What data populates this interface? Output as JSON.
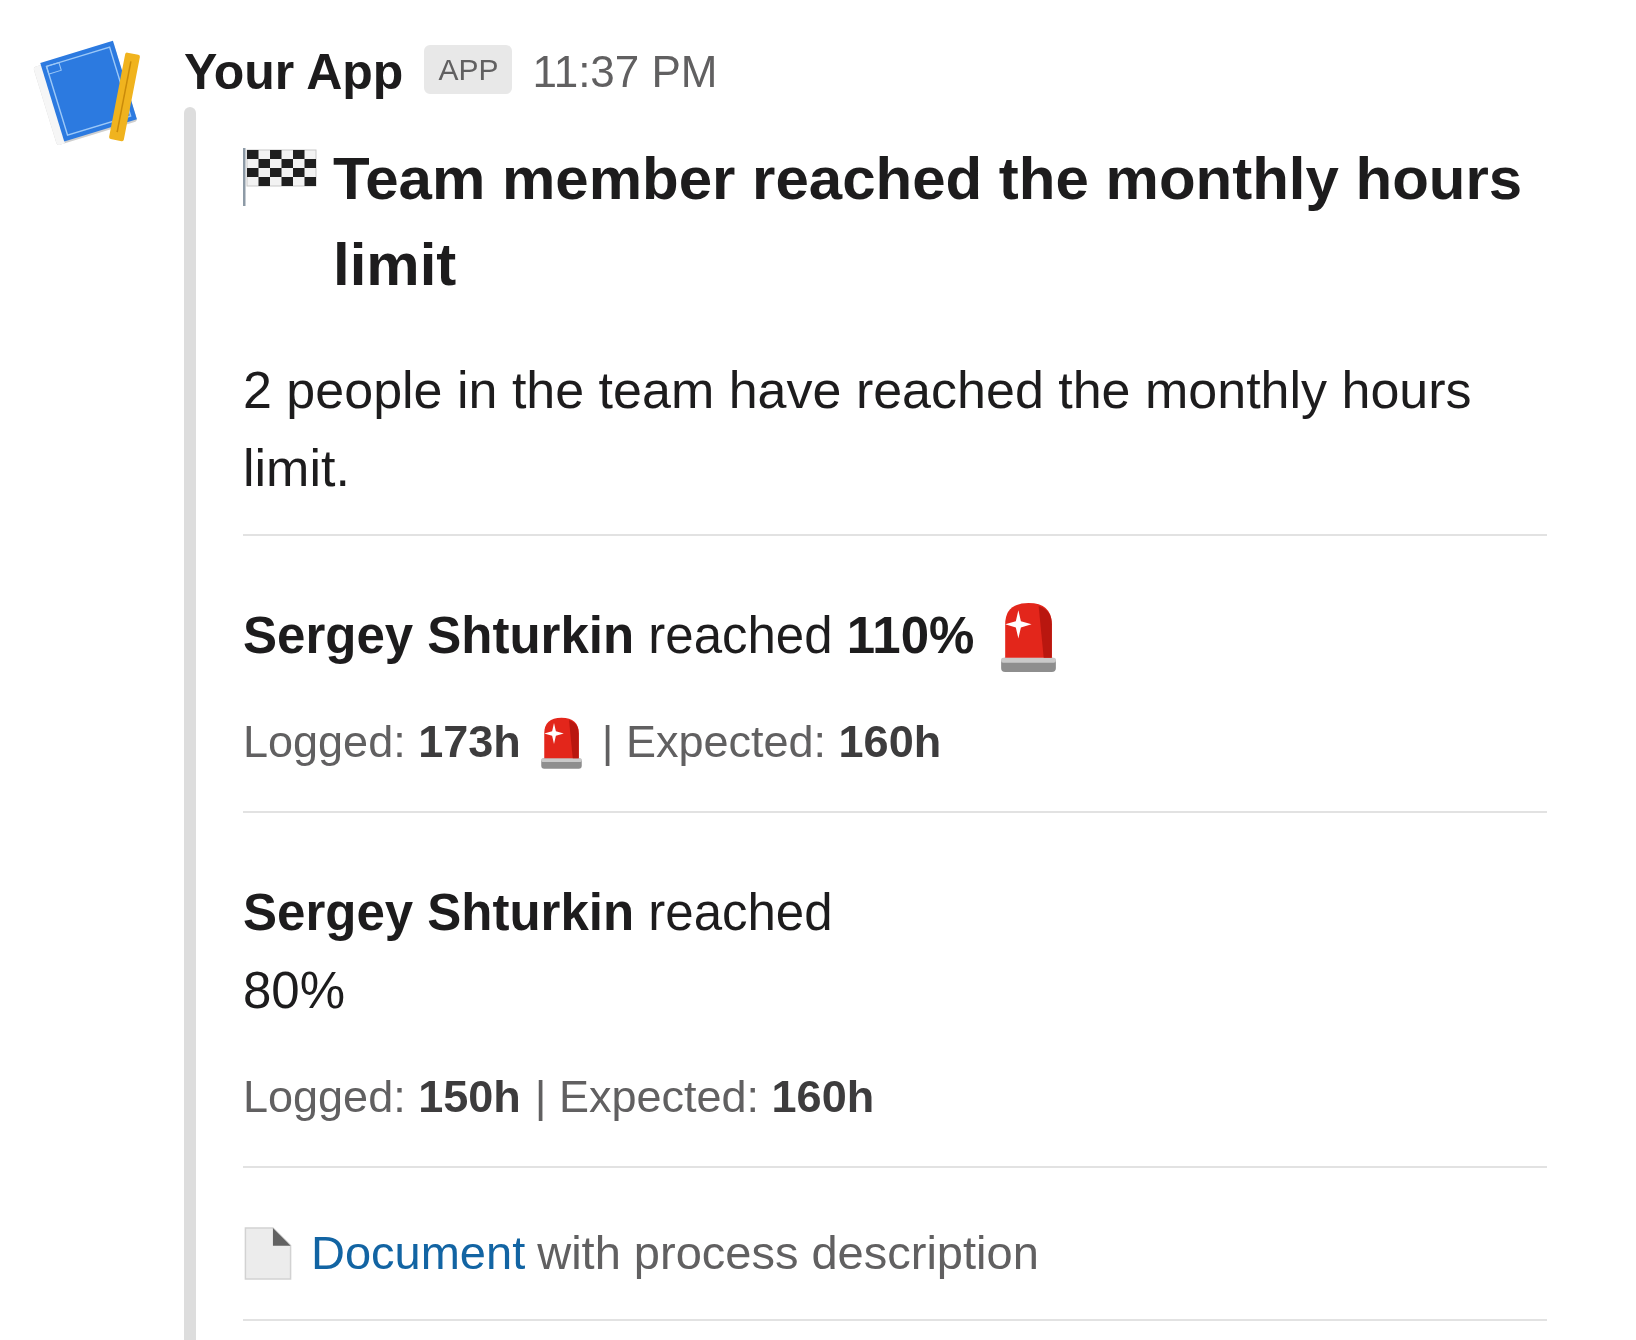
{
  "message": {
    "sender": "Your App",
    "badge": "APP",
    "time": "11:37 PM"
  },
  "attachment": {
    "title": "Team member reached the monthly hours limit",
    "description": "2 people in the team have reached the monthly hours limit.",
    "people": [
      {
        "heading_lines": [
          "**Sergey Shturkin** reached **110%**"
        ],
        "alert": true,
        "logged": "Logged: **173h**",
        "logged_alert": true,
        "expected": "| Expected: **160h**"
      },
      {
        "heading_lines": [
          "**Sergey Shturkin** reached",
          "80%"
        ],
        "alert": false,
        "logged": "Logged: **150h**",
        "logged_alert": false,
        "expected": "| Expected: **160h**"
      }
    ],
    "link": {
      "link_text": "Document",
      "text": "with process description"
    }
  }
}
